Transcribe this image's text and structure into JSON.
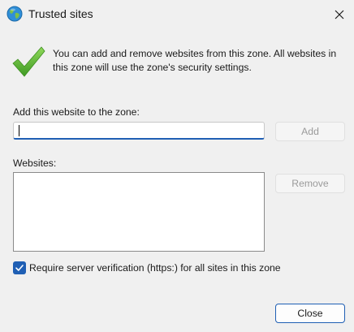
{
  "window": {
    "title": "Trusted sites",
    "icon": "globe-icon",
    "close_icon": "close-icon"
  },
  "info": {
    "icon": "checkmark-icon",
    "text": "You can add and remove websites from this zone. All websites in this zone will use the zone's security settings."
  },
  "add_site": {
    "label": "Add this website to the zone:",
    "value": "",
    "button_label": "Add",
    "button_enabled": false
  },
  "websites": {
    "label": "Websites:",
    "items": [],
    "remove_button_label": "Remove",
    "remove_button_enabled": false
  },
  "verification": {
    "label": "Require server verification (https:) for all sites in this zone",
    "checked": true
  },
  "footer": {
    "close_label": "Close"
  },
  "colors": {
    "accent": "#1f5fb4",
    "check_green": "#5fb832",
    "disabled_text": "#9a9a9a"
  }
}
